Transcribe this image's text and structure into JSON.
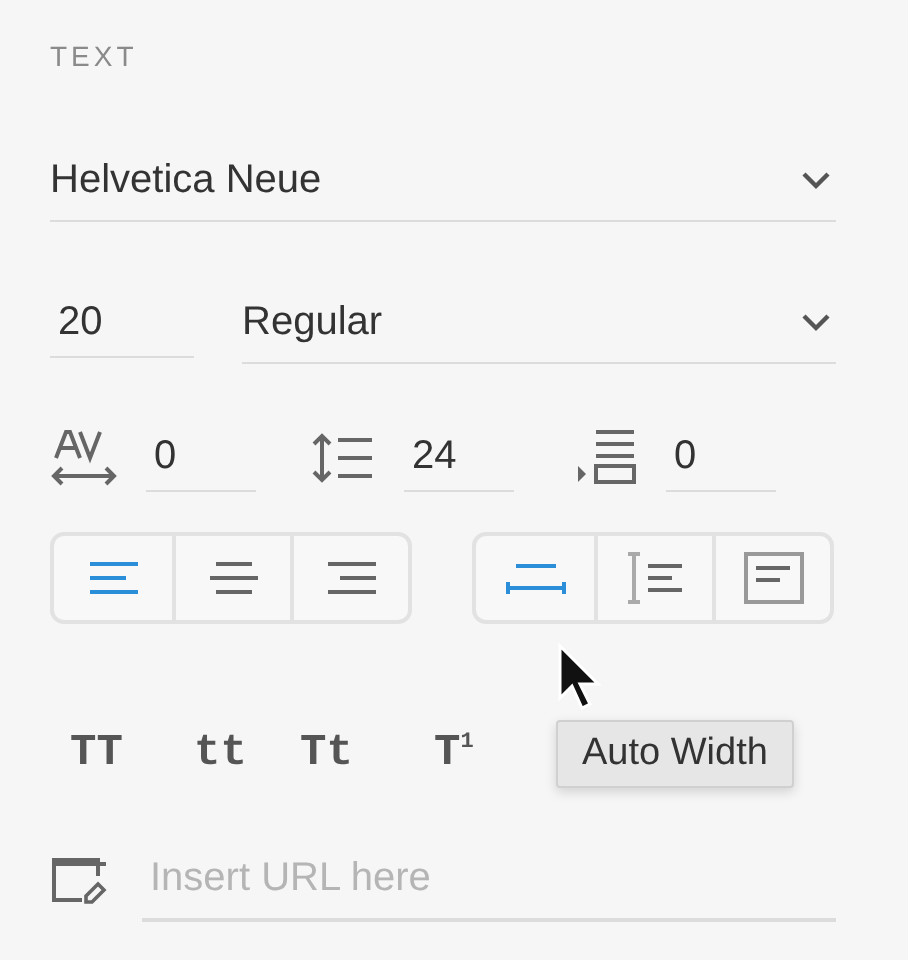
{
  "section_title": "TEXT",
  "font_family": {
    "value": "Helvetica Neue"
  },
  "font_size": {
    "value": "20"
  },
  "font_weight": {
    "value": "Regular"
  },
  "spacing": [
    {
      "kind": "character",
      "value": "0"
    },
    {
      "kind": "line",
      "value": "24"
    },
    {
      "kind": "paragraph",
      "value": "0"
    }
  ],
  "alignment": [
    {
      "kind": "left",
      "selected": true
    },
    {
      "kind": "center",
      "selected": false
    },
    {
      "kind": "right",
      "selected": false
    }
  ],
  "sizing": [
    {
      "kind": "auto-width",
      "selected": true
    },
    {
      "kind": "auto-height",
      "selected": false
    },
    {
      "kind": "fixed",
      "selected": false
    }
  ],
  "text_transforms": [
    {
      "label": "TT"
    },
    {
      "label": "tt"
    },
    {
      "label": "Tt"
    },
    {
      "label": "T$^{1}$"
    }
  ],
  "tooltip": "Auto Width",
  "url_field": {
    "placeholder": "Insert URL here"
  }
}
